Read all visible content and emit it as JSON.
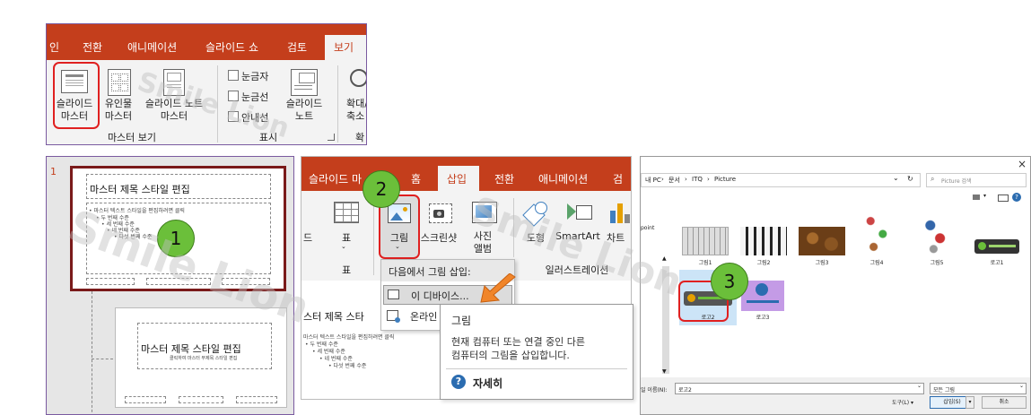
{
  "panel1": {
    "tabs": [
      "인",
      "전환",
      "애니메이션",
      "슬라이드 쇼",
      "검토",
      "보기"
    ],
    "slide_master_label": "슬라이드\n마스터",
    "handout_master_label": "유인물\n마스터",
    "notes_master_label": "슬라이드 노트\n마스터",
    "master_views_group": "마스터 보기",
    "ruler": "눈금자",
    "gridlines": "눈금선",
    "guides": "안내선",
    "notes_label": "슬라이드\n노트",
    "show_group": "표시",
    "zoom_label": "확대/\n축소",
    "zoom_group": "확"
  },
  "panel2": {
    "slide_number": "1",
    "master_title": "마스터 제목 스타일 편집",
    "master_text": "• 마스터 텍스트 스타일을 편집하려면 클릭",
    "levels": [
      "• 두 번째 수준",
      "• 세 번째 수준",
      "• 네 번째 수준",
      "• 다섯 번째 수준"
    ],
    "layout_title": "마스터 제목 스타일 편집",
    "layout_subtitle": "클릭하여 마스터 부제목 스타일 편집"
  },
  "panel3": {
    "tabs": [
      "슬라이드 마",
      "홈",
      "삽입",
      "전환",
      "애니메이션",
      "검토"
    ],
    "table_label": "표",
    "table_group": "표",
    "picture_label": "그림",
    "screenshot_label": "스크린샷",
    "photo_album_label": "사진\n앨범",
    "shapes_label": "도형",
    "smartart_label": "SmartArt",
    "chart_label": "차트",
    "illustrations_group": "일러스트레이션",
    "menu_header": "다음에서 그림 삽입:",
    "menu_this_device": "이 디바이스...",
    "menu_online": "온라인",
    "tooltip_title": "그림",
    "tooltip_body": "현재 컴퓨터 또는 연결 중인 다른\n컴퓨터의 그림을 삽입합니다.",
    "tooltip_more": "자세히",
    "slide_title": "스터 제목 스타",
    "slide_text": "마스터 텍스트 스타일을 편집하려면 클릭",
    "levels": [
      "• 두 번째 수준",
      "• 세 번째 수준",
      "• 네 번째 수준",
      "• 다섯 번째 수준"
    ]
  },
  "panel4": {
    "path": [
      "내 PC",
      "문서",
      "ITQ",
      "Picture"
    ],
    "search_placeholder": "Picture 검색",
    "side_label": "point",
    "files": [
      "그림1",
      "그림2",
      "그림3",
      "그림4",
      "그림5",
      "로고1",
      "로고2",
      "로고3"
    ],
    "filename_label": "일 이름(N):",
    "filename_value": "로고2",
    "filetype_value": "모든 그림",
    "tools_label": "도구(L)",
    "insert_label": "삽입(S)",
    "cancel_label": "취소",
    "close_glyph": "×"
  },
  "steps": [
    "1",
    "2",
    "3"
  ],
  "watermark": "Smile Lion",
  "colors": {
    "accent": "#b7472a",
    "ppt_red": "#c43e1c",
    "step_green": "#6bbf3a",
    "highlight_red": "#e02020",
    "purple_border": "#6a4a8a"
  }
}
